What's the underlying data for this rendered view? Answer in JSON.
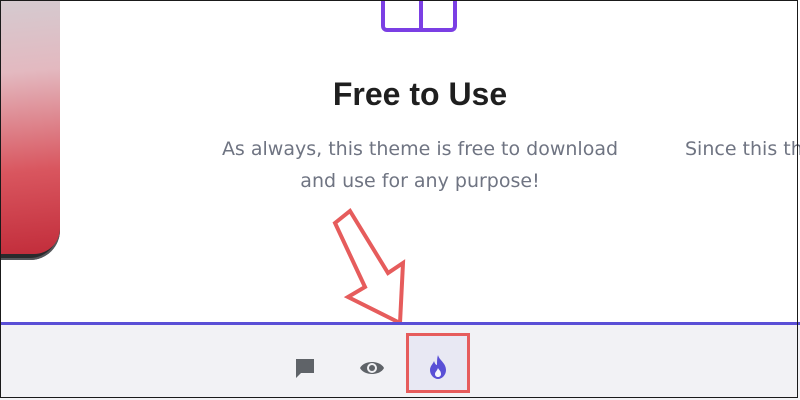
{
  "feature": {
    "title": "Free to Use",
    "description_line1": "As always, this theme is free to download",
    "description_line2": "and use for any purpose!"
  },
  "next_feature": {
    "description_fragment": "Since this th"
  },
  "toolbar": {
    "items": [
      {
        "icon": "comment-icon"
      },
      {
        "icon": "eye-icon"
      },
      {
        "icon": "flame-icon",
        "active": true
      }
    ]
  },
  "colors": {
    "accent": "#7b3fe4",
    "toolbar_divider": "#5a4fd6",
    "annotation": "#e65c5c",
    "icon_gray": "#5f6368",
    "flame": "#5a4fd6"
  }
}
